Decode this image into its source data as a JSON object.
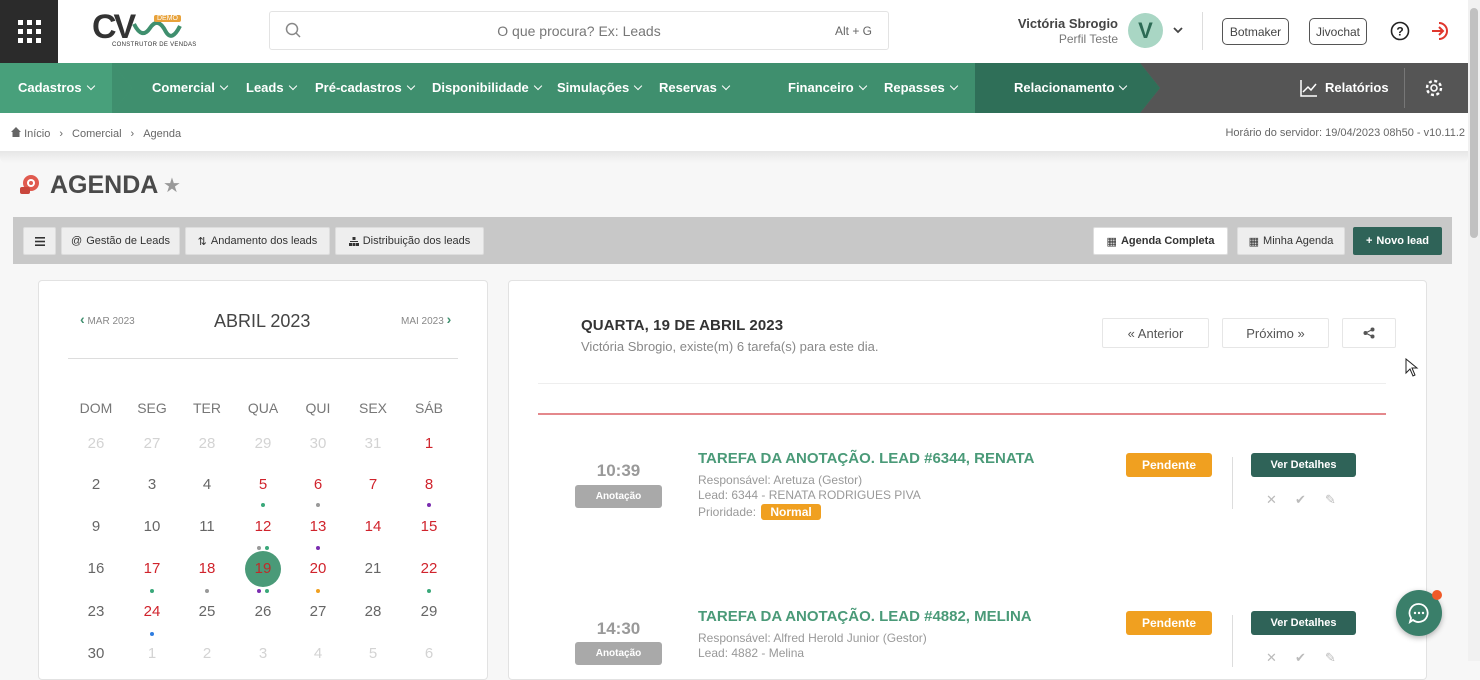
{
  "header": {
    "logo_text": "CV",
    "logo_badge": "DEMO",
    "logo_sub": "CONSTRUTOR DE VENDAS",
    "search_placeholder": "O que procura? Ex: Leads",
    "search_shortcut": "Alt + G",
    "user_name": "Victória Sbrogio",
    "user_role": "Perfil Teste",
    "avatar_letter": "V",
    "botmaker_label": "Botmaker",
    "jivochat_label": "Jivochat"
  },
  "nav": {
    "items": [
      "Cadastros",
      "Comercial",
      "Leads",
      "Pré-cadastros",
      "Disponibilidade",
      "Simulações",
      "Reservas",
      "Financeiro",
      "Repasses",
      "Relacionamento"
    ],
    "reports_label": "Relatórios"
  },
  "breadcrumb": {
    "items": [
      "Início",
      "Comercial",
      "Agenda"
    ],
    "server_time": "Horário do servidor: 19/04/2023 08h50 - v10.11.2"
  },
  "page": {
    "title": "AGENDA"
  },
  "toolbar": {
    "leads_mgmt": "Gestão de Leads",
    "leads_progress": "Andamento dos leads",
    "leads_distribution": "Distribuição dos leads",
    "full_agenda": "Agenda Completa",
    "my_agenda": "Minha Agenda",
    "new_lead": "Novo lead"
  },
  "calendar": {
    "prev_month": "MAR 2023",
    "month": "ABRIL 2023",
    "next_month": "MAI 2023",
    "weekdays": [
      "DOM",
      "SEG",
      "TER",
      "QUA",
      "QUI",
      "SEX",
      "SÁB"
    ],
    "weeks": [
      [
        "26",
        "27",
        "28",
        "29",
        "30",
        "31",
        "1"
      ],
      [
        "2",
        "3",
        "4",
        "5",
        "6",
        "7",
        "8"
      ],
      [
        "9",
        "10",
        "11",
        "12",
        "13",
        "14",
        "15"
      ],
      [
        "16",
        "17",
        "18",
        "19",
        "20",
        "21",
        "22"
      ],
      [
        "23",
        "24",
        "25",
        "26",
        "27",
        "28",
        "29"
      ],
      [
        "30",
        "1",
        "2",
        "3",
        "4",
        "5",
        "6"
      ]
    ]
  },
  "day_view": {
    "title": "QUARTA, 19 DE ABRIL 2023",
    "subtitle": "Victória Sbrogio, existe(m) 6 tarefa(s) para este dia.",
    "prev_label": "« Anterior",
    "next_label": "Próximo »"
  },
  "tasks": [
    {
      "time": "10:39",
      "tag": "Anotação",
      "title": "TAREFA DA ANOTAÇÃO. LEAD #6344, RENATA",
      "responsible": "Responsável: Aretuza (Gestor)",
      "lead": "Lead: 6344 - RENATA RODRIGUES PIVA",
      "priority_label": "Prioridade:",
      "priority": "Normal",
      "status": "Pendente",
      "details_label": "Ver Detalhes"
    },
    {
      "time": "14:30",
      "tag": "Anotação",
      "title": "TAREFA DA ANOTAÇÃO. LEAD #4882, MELINA",
      "responsible": "Responsável: Alfred Herold Junior (Gestor)",
      "lead": "Lead: 4882 - Melina",
      "status": "Pendente",
      "details_label": "Ver Detalhes"
    }
  ],
  "colors": {
    "nav_green": "#3f8f6e",
    "button_dark_green": "#2f6358",
    "pending_orange": "#f0a020",
    "task_title_green": "#4a9a78",
    "weekend_red": "#d0232c"
  }
}
